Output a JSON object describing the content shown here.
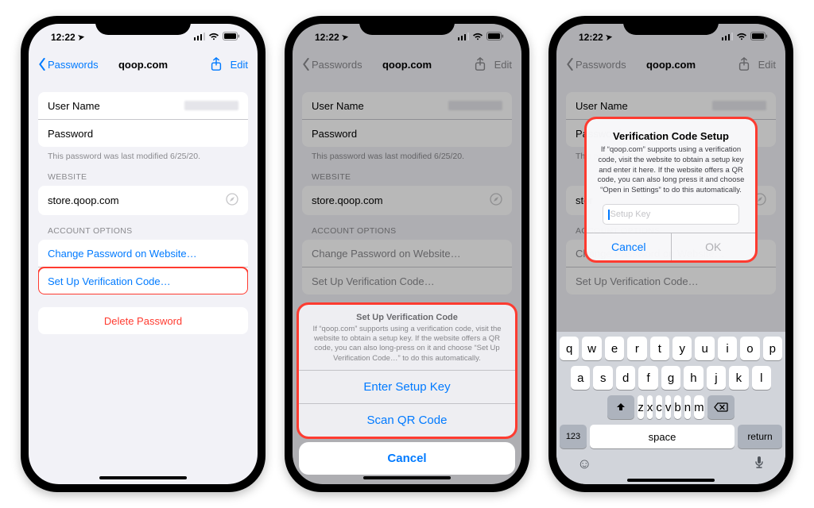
{
  "status": {
    "time": "12:22",
    "location_arrow": "➤",
    "signal": "▮▮▮▯",
    "wifi": "wifi",
    "battery": "battery"
  },
  "nav": {
    "back_label": "Passwords",
    "title": "qoop.com",
    "edit_label": "Edit"
  },
  "fields": {
    "username_label": "User Name",
    "password_label": "Password",
    "last_modified_note": "This password was last modified 6/25/20.",
    "website_header": "WEBSITE",
    "website_value": "store.qoop.com",
    "account_options_header": "ACCOUNT OPTIONS",
    "change_pw_label": "Change Password on Website…",
    "setup_code_label": "Set Up Verification Code…",
    "delete_label": "Delete Password"
  },
  "action_sheet": {
    "title": "Set Up Verification Code",
    "description": "If “qoop.com” supports using a verification code, visit the website to obtain a setup key. If the website offers a QR code, you can also long-press on it and choose “Set Up Verification Code…” to do this automatically.",
    "enter_key_label": "Enter Setup Key",
    "scan_qr_label": "Scan QR Code",
    "cancel_label": "Cancel"
  },
  "alert": {
    "title": "Verification Code Setup",
    "message": "If “qoop.com” supports using a verification code, visit the website to obtain a setup key and enter it here. If the website offers a QR code, you can also long press it and choose “Open in Settings” to do this automatically.",
    "placeholder": "Setup Key",
    "cancel_label": "Cancel",
    "ok_label": "OK"
  },
  "keyboard": {
    "row1": [
      "q",
      "w",
      "e",
      "r",
      "t",
      "y",
      "u",
      "i",
      "o",
      "p"
    ],
    "row2": [
      "a",
      "s",
      "d",
      "f",
      "g",
      "h",
      "j",
      "k",
      "l"
    ],
    "row3": [
      "z",
      "x",
      "c",
      "v",
      "b",
      "n",
      "m"
    ],
    "num_label": "123",
    "space_label": "space",
    "return_label": "return"
  }
}
